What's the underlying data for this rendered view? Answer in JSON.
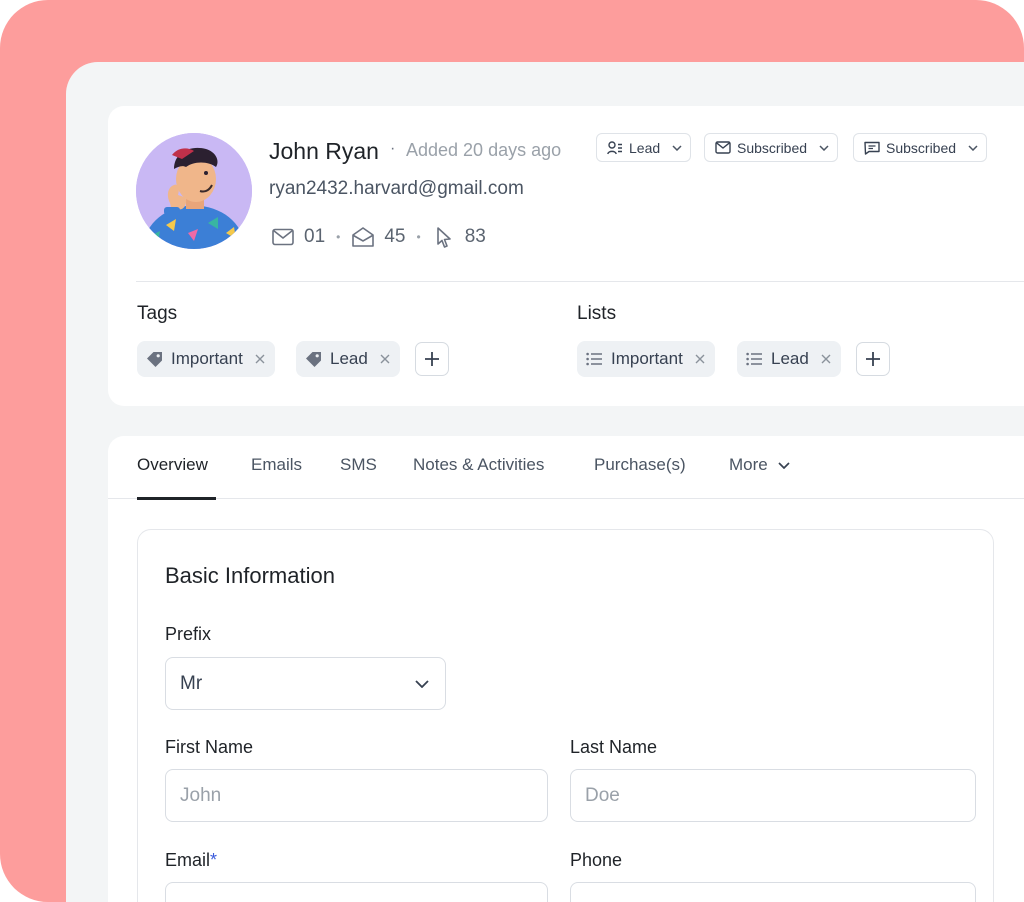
{
  "contact": {
    "name": "John Ryan",
    "separator": "·",
    "added": "Added 20 days ago",
    "email": "ryan2432.harvard@gmail.com",
    "stats": [
      {
        "icon": "mail-icon",
        "value": "01"
      },
      {
        "icon": "mail-open-icon",
        "value": "45"
      },
      {
        "icon": "cursor-click-icon",
        "value": "83"
      }
    ]
  },
  "header_pills": [
    {
      "icon": "contact-status-icon",
      "label": "Lead"
    },
    {
      "icon": "mail-icon",
      "label": "Subscribed"
    },
    {
      "icon": "sms-icon",
      "label": "Subscribed"
    }
  ],
  "tags": {
    "label": "Tags",
    "items": [
      "Important",
      "Lead"
    ]
  },
  "lists": {
    "label": "Lists",
    "items": [
      "Important",
      "Lead"
    ]
  },
  "tabs": [
    "Overview",
    "Emails",
    "SMS",
    "Notes & Activities",
    "Purchase(s)",
    "More"
  ],
  "active_tab": "Overview",
  "form": {
    "title": "Basic Information",
    "prefix": {
      "label": "Prefix",
      "value": "Mr"
    },
    "first_name": {
      "label": "First Name",
      "placeholder": "John"
    },
    "last_name": {
      "label": "Last Name",
      "placeholder": "Doe"
    },
    "email": {
      "label": "Email",
      "required_mark": "*"
    },
    "phone": {
      "label": "Phone"
    }
  },
  "colors": {
    "backdrop": "#fd9d9c",
    "panel": "#f3f5f6",
    "accent": "#3b5bdb",
    "avatar_bg": "#c9b8f4"
  }
}
